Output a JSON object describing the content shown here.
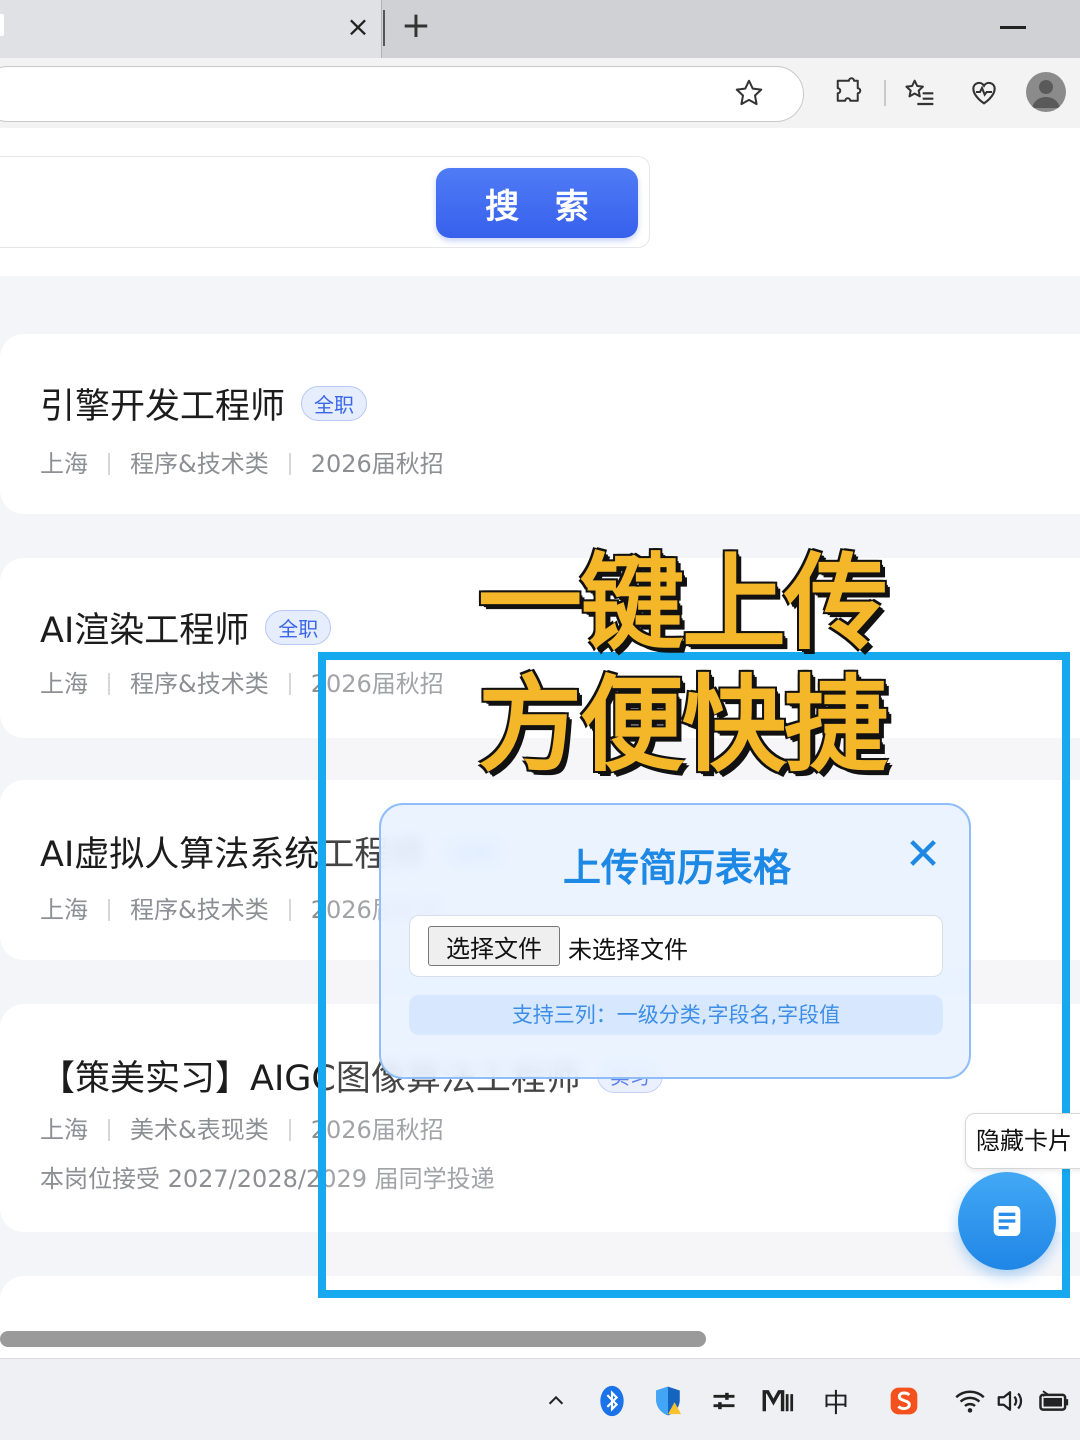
{
  "browser": {
    "tab_close": "×",
    "new_tab": "+"
  },
  "search": {
    "button_label": "搜 索"
  },
  "jobs": [
    {
      "title": "引擎开发工程师",
      "badge": "全职",
      "city": "上海",
      "category": "程序&技术类",
      "batch": "2026届秋招"
    },
    {
      "title": "AI渲染工程师",
      "badge": "全职",
      "city": "上海",
      "category": "程序&技术类",
      "batch": "2026届秋招"
    },
    {
      "title": "AI虚拟人算法系统工程师",
      "badge": "全职",
      "city": "上海",
      "category": "程序&技术类",
      "batch": "2026届秋招"
    },
    {
      "title": "【策美实习】AIGC图像算法工程师",
      "badge": "实习",
      "city": "上海",
      "category": "美术&表现类",
      "batch": "2026届秋招",
      "note": "本岗位接受 2027/2028/2029 届同学投递"
    }
  ],
  "overlay": {
    "line1": "一键上传",
    "line2": "方便快捷"
  },
  "upload_modal": {
    "title": "上传简历表格",
    "close": "✕",
    "file_button": "选择文件",
    "file_status": "未选择文件",
    "hint": "支持三列：一级分类,字段名,字段值"
  },
  "floating": {
    "hide_card": "隐藏卡片"
  },
  "taskbar": {
    "ime": "中"
  },
  "colors": {
    "accent": "#3760ec",
    "frame": "#16a9ef",
    "headline": "#f4b72a",
    "modal_title": "#1e88e5"
  }
}
